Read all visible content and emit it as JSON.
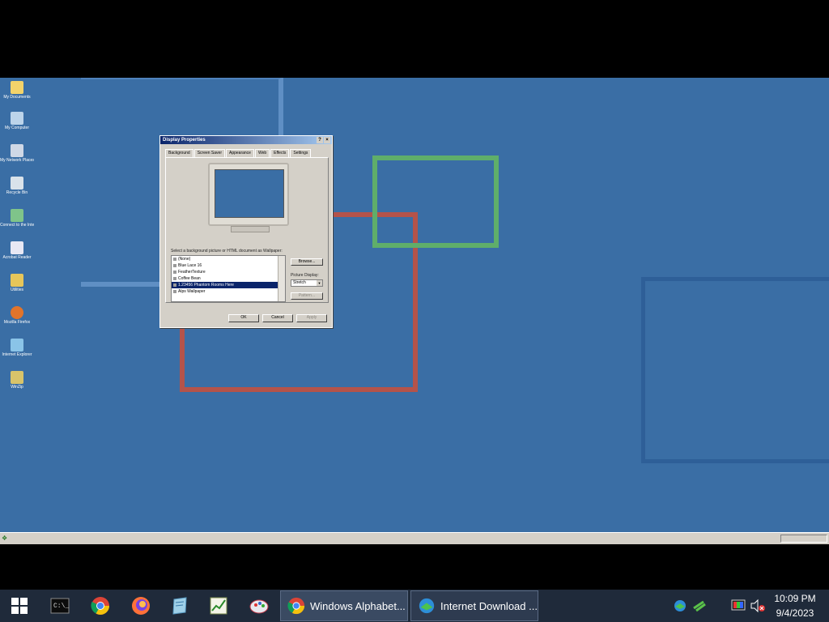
{
  "desktop_icons": [
    {
      "label": "My Documents",
      "icon": "folder-icon",
      "color": "#f3d36a"
    },
    {
      "label": "My Computer",
      "icon": "computer-icon",
      "color": "#bcd4ea"
    },
    {
      "label": "My Network Places",
      "icon": "network-icon",
      "color": "#cfd8e6"
    },
    {
      "label": "Recycle Bin",
      "icon": "recycle-bin-icon",
      "color": "#d9e2ea"
    },
    {
      "label": "Connect to the Internet",
      "icon": "internet-connect-icon",
      "color": "#7fc48a"
    },
    {
      "label": "Acrobat Reader",
      "icon": "acrobat-icon",
      "color": "#e8e8f4"
    },
    {
      "label": "Utilities",
      "icon": "utilities-icon",
      "color": "#e6c65a"
    },
    {
      "label": "Mozilla Firefox",
      "icon": "firefox-icon",
      "color": "#e2742a"
    },
    {
      "label": "Internet Explorer",
      "icon": "ie-icon",
      "color": "#8ac4e8"
    },
    {
      "label": "WinZip",
      "icon": "winzip-icon",
      "color": "#d8c46a"
    }
  ],
  "dialog": {
    "title": "Display Properties",
    "close": "×",
    "help": "?",
    "tabs": [
      "Background",
      "Screen Saver",
      "Appearance",
      "Web",
      "Effects",
      "Settings"
    ],
    "select_label": "Select a background picture or HTML document as Wallpaper:",
    "list_items": [
      "(None)",
      "Blue Lace 16",
      "FeatherTexture",
      "Coffee Bean",
      "1.23456 Phantom Rooms Here",
      "Alps Wallpaper"
    ],
    "selected_index": 4,
    "browse_button": "Browse...",
    "picture_display_label": "Picture Display:",
    "picture_display_value": "Stretch",
    "pattern_button": "Pattern...",
    "ok_button": "OK",
    "cancel_button": "Cancel",
    "apply_button": "Apply"
  },
  "w2k_taskbar": {
    "start_glyph": "❖",
    "tray_text": ""
  },
  "taskbar": {
    "apps": [
      {
        "name": "Command Prompt",
        "icon": "terminal-icon"
      },
      {
        "name": "Google Chrome",
        "icon": "chrome-icon"
      },
      {
        "name": "Firefox",
        "icon": "firefox-icon"
      },
      {
        "name": "Notepad",
        "icon": "notepad-icon"
      },
      {
        "name": "Task Manager",
        "icon": "chart-icon"
      },
      {
        "name": "Paint",
        "icon": "paint-icon"
      }
    ],
    "windows": [
      {
        "label": "Windows Alphabet...",
        "icon": "chrome-icon"
      },
      {
        "label": "Internet Download ...",
        "icon": "idm-icon"
      }
    ],
    "clock": {
      "time": "10:09 PM",
      "date": "9/4/2023"
    }
  },
  "colors": {
    "desktop": "#3a6ea5",
    "taskbar": "#1f2a3a",
    "dialog_bg": "#d4d0c8",
    "selection": "#0a246a"
  }
}
